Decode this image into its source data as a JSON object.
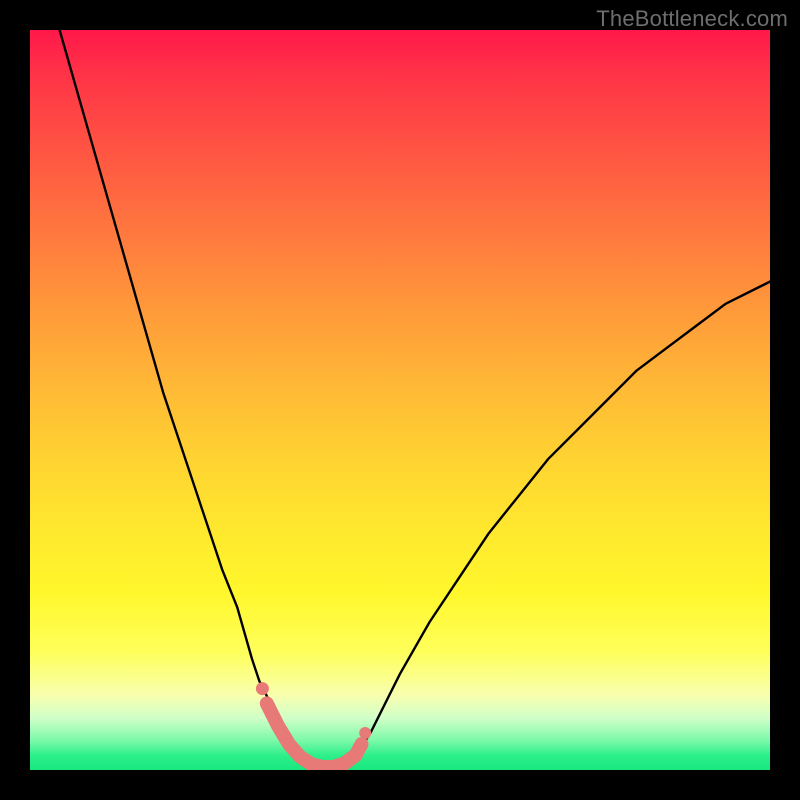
{
  "watermark": "TheBottleneck.com",
  "colors": {
    "frame": "#000000",
    "curve": "#000000",
    "marker": "#e77a77",
    "gradient_top": "#ff184a",
    "gradient_bottom": "#17e77e"
  },
  "chart_data": {
    "type": "line",
    "title": "",
    "xlabel": "",
    "ylabel": "",
    "xlim": [
      0,
      100
    ],
    "ylim": [
      0,
      100
    ],
    "grid": false,
    "legend": false,
    "series": [
      {
        "name": "curve",
        "x": [
          4,
          6,
          8,
          10,
          12,
          14,
          16,
          18,
          20,
          22,
          24,
          26,
          28,
          30,
          31,
          32,
          33,
          34,
          35,
          36,
          37,
          38,
          39,
          40,
          41,
          42,
          43,
          44,
          46,
          48,
          50,
          54,
          58,
          62,
          66,
          70,
          74,
          78,
          82,
          86,
          90,
          94,
          98,
          100
        ],
        "y": [
          100,
          93,
          86,
          79,
          72,
          65,
          58,
          51,
          45,
          39,
          33,
          27,
          22,
          15,
          12,
          10,
          8,
          6,
          4.5,
          3,
          2,
          1.2,
          0.6,
          0.2,
          0.1,
          0.3,
          0.8,
          2,
          5,
          9,
          13,
          20,
          26,
          32,
          37,
          42,
          46,
          50,
          54,
          57,
          60,
          63,
          65,
          66
        ]
      },
      {
        "name": "markers",
        "x": [
          32,
          33.5,
          35,
          36.5,
          38,
          39.5,
          41,
          42.5,
          44,
          44.8
        ],
        "y": [
          9,
          6,
          3.5,
          1.8,
          0.8,
          0.4,
          0.4,
          0.9,
          2,
          3.5
        ]
      }
    ]
  }
}
